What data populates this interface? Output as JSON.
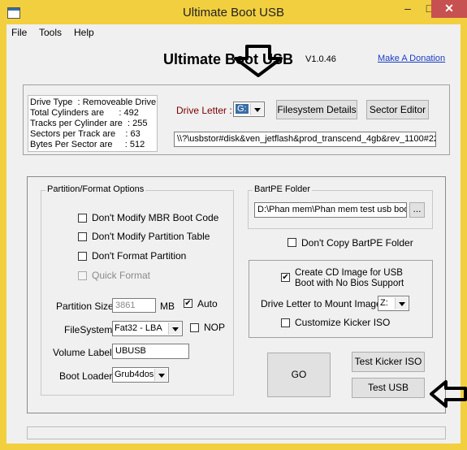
{
  "window": {
    "title": "Ultimate Boot USB",
    "minimize": "–",
    "maximize": "□",
    "close": "✕"
  },
  "menu": [
    "File",
    "Tools",
    "Help"
  ],
  "header": {
    "title": "Ultimate Boot USB",
    "version": "V1.0.46",
    "donation": "Make A Donation"
  },
  "drive_info": [
    "Drive Type  : Removeable Drive",
    "Total Cylinders are      : 492",
    "Tracks per Cylinder are  : 255",
    "Sectors per Track are    : 63",
    "Bytes Per Sector are     : 512"
  ],
  "drive_letter": {
    "label": "Drive Letter :",
    "value": "G:"
  },
  "buttons": {
    "filesystem_details": "Filesystem Details",
    "sector_editor": "Sector Editor",
    "go": "GO",
    "test_kicker": "Test Kicker ISO",
    "test_usb": "Test USB",
    "browse": "..."
  },
  "device_path": "\\\\?\\usbstor#disk&ven_jetflash&prod_transcend_4gb&rev_1100#22",
  "partition": {
    "legend": "Partition/Format Options",
    "dont_modify_mbr": "Don't Modify MBR Boot Code",
    "dont_modify_partition": "Don't Modify Partition Table",
    "dont_format": "Don't Format Partition",
    "quick_format": "Quick Format",
    "size_label": "Partition Size",
    "size_value": "3861",
    "size_unit": "MB",
    "auto_label": "Auto",
    "filesystem_label": "FileSystem",
    "filesystem_value": "Fat32 - LBA",
    "nop_label": "NOP",
    "volume_label": "Volume Label",
    "volume_value": "UBUSB",
    "boot_loader_label": "Boot Loader",
    "boot_loader_value": "Grub4dos"
  },
  "bartpe": {
    "legend": "BartPE Folder",
    "path": "D:\\Phan mem\\Phan mem test usb boo",
    "dont_copy": "Don't Copy BartPE Folder"
  },
  "cd_image": {
    "create_line1": "Create CD Image for USB",
    "create_line2": "Boot with No Bios Support",
    "mount_label": "Drive Letter to Mount Image",
    "mount_value": "Z:",
    "customize": "Customize Kicker ISO"
  },
  "checks": {
    "auto": "✔",
    "create_cd": "✔"
  }
}
